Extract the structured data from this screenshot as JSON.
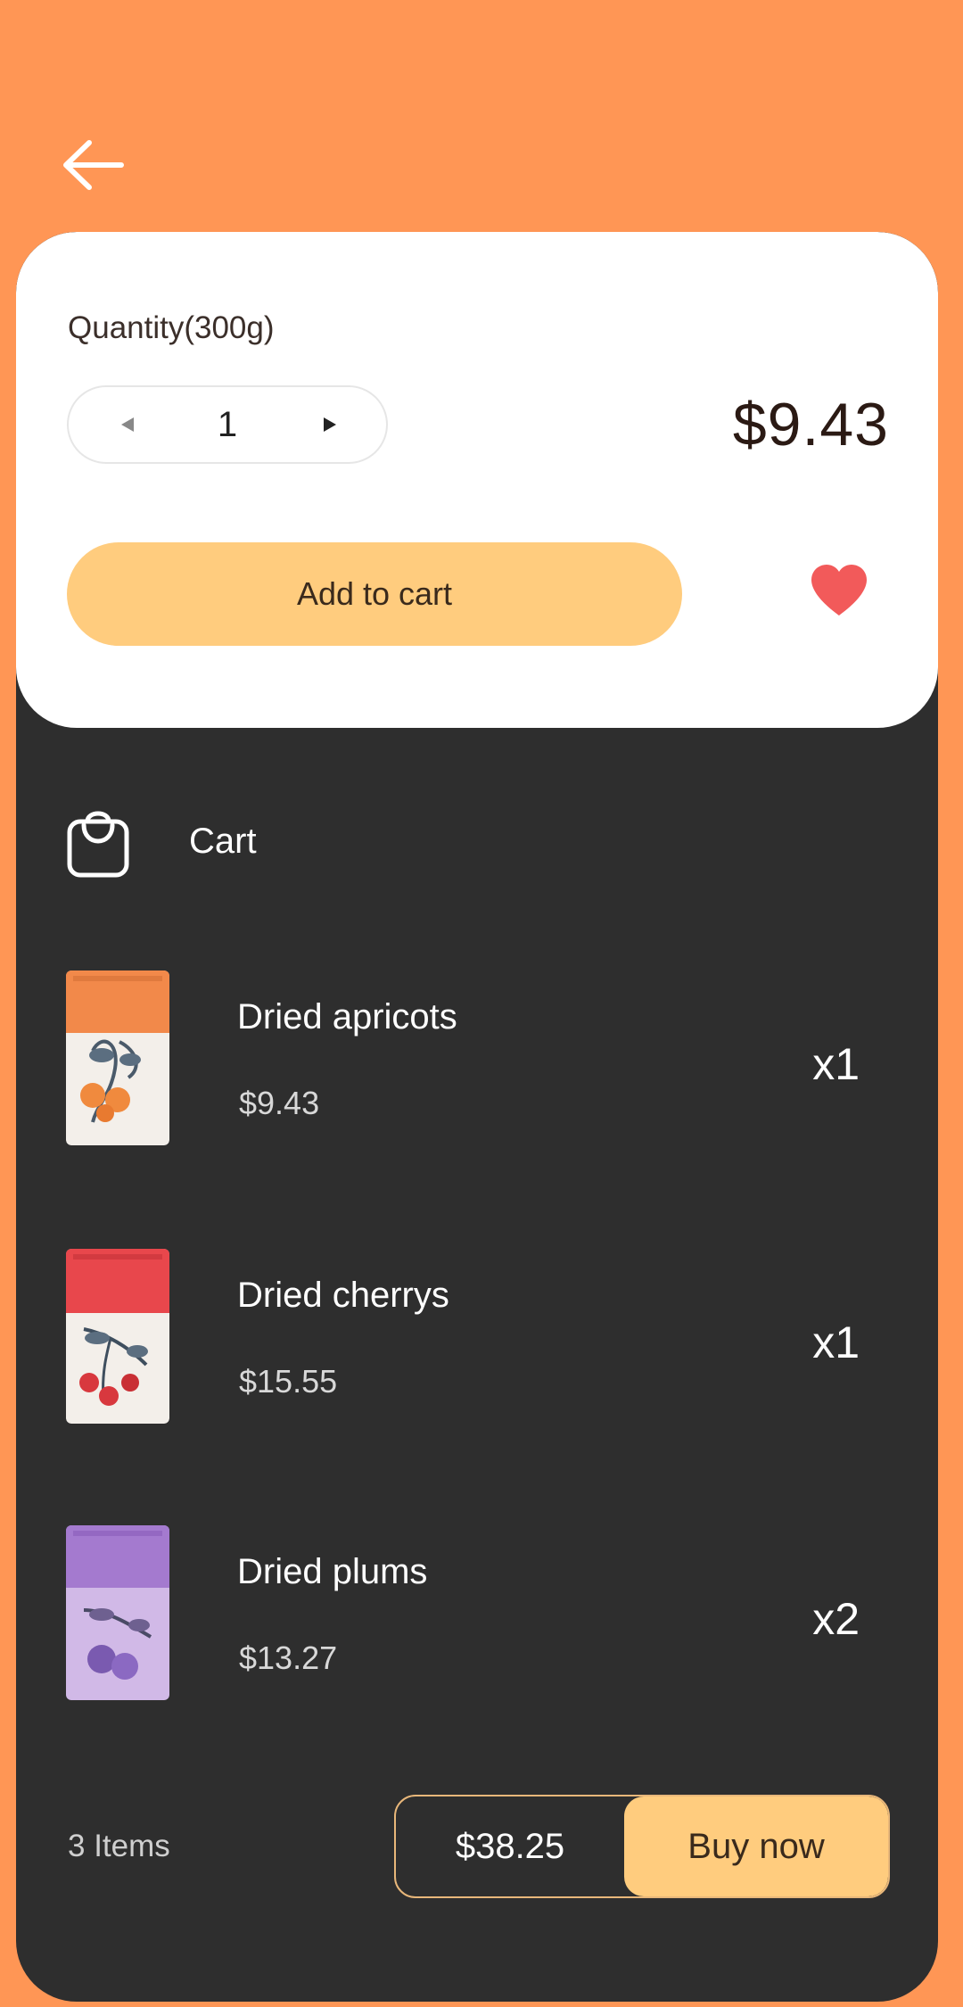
{
  "header": {
    "back_icon": "arrow-left-icon"
  },
  "product": {
    "quantity_label": "Quantity(300g)",
    "quantity": "1",
    "price": "$9.43",
    "add_to_cart_label": "Add to cart",
    "favorite_icon": "heart-icon",
    "favorite_color": "#F25A5A"
  },
  "cart": {
    "title": "Cart",
    "icon": "shopping-bag-icon",
    "items": [
      {
        "name": "Dried apricots",
        "price": "$9.43",
        "qty": "x1",
        "pack_color": "#F2894A"
      },
      {
        "name": "Dried cherrys",
        "price": "$15.55",
        "qty": "x1",
        "pack_color": "#E8474C"
      },
      {
        "name": "Dried plums",
        "price": "$13.27",
        "qty": "x2",
        "pack_color": "#A47ACF"
      }
    ]
  },
  "footer": {
    "items_count": "3 Items",
    "total": "$38.25",
    "buy_label": "Buy now"
  },
  "colors": {
    "background": "#FF9655",
    "panel": "#2E2E2E",
    "card": "#FFFFFF",
    "accent": "#FFCC7E"
  }
}
